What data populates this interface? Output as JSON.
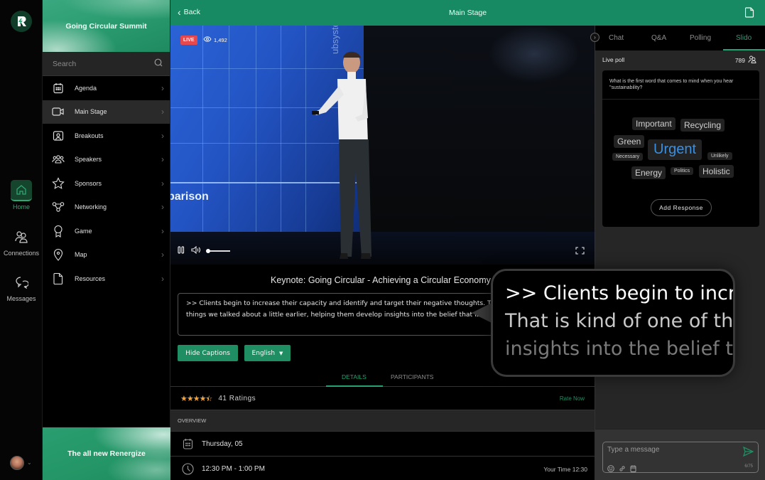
{
  "rail": {
    "items": [
      {
        "label": "Home",
        "icon": "home-icon",
        "active": true
      },
      {
        "label": "Connections",
        "icon": "people-icon",
        "active": false
      },
      {
        "label": "Messages",
        "icon": "chat-bubbles-icon",
        "active": false
      }
    ]
  },
  "sidebar": {
    "banner_title": "Going Circular Summit",
    "search_placeholder": "Search",
    "items": [
      {
        "label": "Agenda",
        "icon": "calendar-icon"
      },
      {
        "label": "Main Stage",
        "icon": "video-camera-icon",
        "active": true
      },
      {
        "label": "Breakouts",
        "icon": "breakout-room-icon"
      },
      {
        "label": "Speakers",
        "icon": "speakers-group-icon"
      },
      {
        "label": "Sponsors",
        "icon": "star-icon"
      },
      {
        "label": "Networking",
        "icon": "network-icon"
      },
      {
        "label": "Game",
        "icon": "badge-ribbon-icon"
      },
      {
        "label": "Map",
        "icon": "map-pin-icon"
      },
      {
        "label": "Resources",
        "icon": "document-icon"
      }
    ],
    "bottom_banner_title": "The all new Renergize"
  },
  "topbar": {
    "back_label": "Back",
    "title": "Main Stage"
  },
  "video": {
    "live_label": "LIVE",
    "viewers": "1,492",
    "screen_text": "parison",
    "screen_vertical_text": "ubsystem",
    "volume_level": 0.05
  },
  "session": {
    "title": "Keynote: Going Circular - Achieving a Circular Economy",
    "captions": ">> Clients begin to increase their capacity and identify and target their negative thoughts. That is kind of one of the things we talked about a little earlier, helping them develop insights into the belief that is negative. We can also assign",
    "hide_captions_label": "Hide Captions",
    "language": "English",
    "tabs": [
      {
        "label": "DETAILS",
        "active": true
      },
      {
        "label": "PARTICIPANTS",
        "active": false
      }
    ],
    "rating_stars": 4.5,
    "ratings_label": "41 Ratings",
    "rate_now_label": "Rate Now",
    "overview_label": "OVERVIEW",
    "date": "Thursday, 05",
    "time_range": "12:30 PM - 1:00 PM",
    "your_time": "Your Time 12:30"
  },
  "right_panel": {
    "tabs": [
      {
        "label": "Chat",
        "active": false
      },
      {
        "label": "Q&A",
        "active": false
      },
      {
        "label": "Polling",
        "active": false
      },
      {
        "label": "Slido",
        "active": true
      }
    ],
    "live_poll_label": "Live poll",
    "participants": "789",
    "question": "What is the first word that comes to mind when you hear \"sustainability?",
    "words": [
      {
        "text": "Important",
        "weight": "medium"
      },
      {
        "text": "Recycling",
        "weight": "medium"
      },
      {
        "text": "Green",
        "weight": "medium"
      },
      {
        "text": "Urgent",
        "weight": "large",
        "color": "#3a8fe0"
      },
      {
        "text": "Necessary",
        "weight": "small"
      },
      {
        "text": "Unlikely",
        "weight": "small"
      },
      {
        "text": "Energy",
        "weight": "medium"
      },
      {
        "text": "Politics",
        "weight": "small"
      },
      {
        "text": "Holistic",
        "weight": "medium"
      }
    ],
    "add_response_label": "Add Response",
    "message_placeholder": "Type a message",
    "message_count": "6/75"
  },
  "zoom_bubble": {
    "lines": [
      ">> Clients begin to increase",
      "That is kind of one of the th",
      "insights into the belief that"
    ]
  },
  "colors": {
    "brand_green": "#188a63",
    "accent_green": "#24a274",
    "live_red": "#e5484d",
    "star_orange": "#f4a53a",
    "urgent_blue": "#3a8fe0"
  }
}
